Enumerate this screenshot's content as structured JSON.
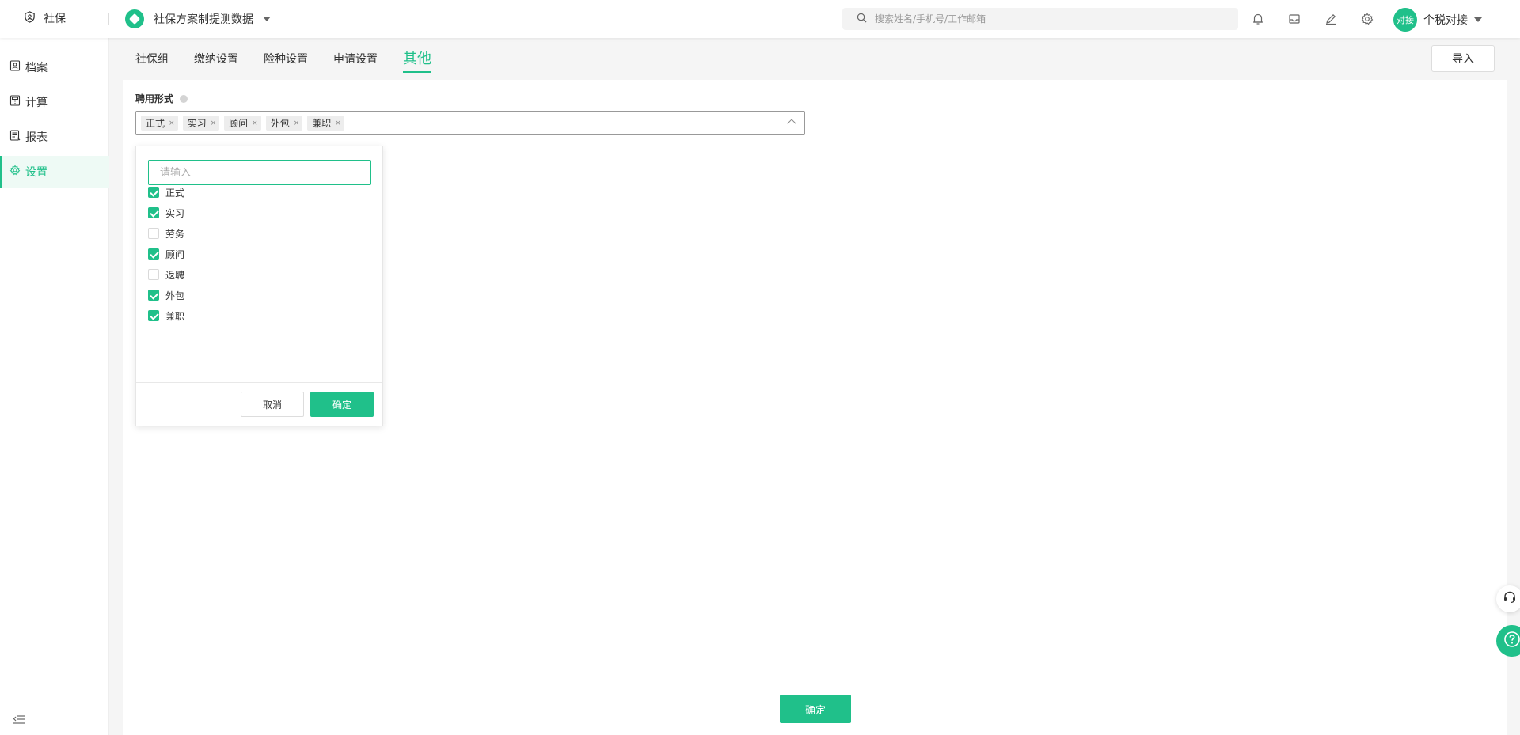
{
  "header": {
    "module_label": "社保",
    "scheme_name": "社保方案制提测数据",
    "search_placeholder": "搜索姓名/手机号/工作邮箱",
    "avatar_text": "对接",
    "user_name": "个税对接"
  },
  "sidebar": {
    "items": [
      {
        "label": "档案",
        "icon": "profile-icon"
      },
      {
        "label": "计算",
        "icon": "calculator-icon"
      },
      {
        "label": "报表",
        "icon": "report-icon"
      },
      {
        "label": "设置",
        "icon": "gear-icon",
        "active": true
      }
    ]
  },
  "tabs": [
    {
      "label": "社保组"
    },
    {
      "label": "缴纳设置"
    },
    {
      "label": "险种设置"
    },
    {
      "label": "申请设置"
    },
    {
      "label": "其他",
      "active": true
    }
  ],
  "import_label": "导入",
  "field": {
    "label": "聘用形式",
    "selected_tags": [
      "正式",
      "实习",
      "顾问",
      "外包",
      "兼职"
    ],
    "tag_close_glyph": "×"
  },
  "dropdown": {
    "search_placeholder": "请输入",
    "options": [
      {
        "label": "正式",
        "checked": true
      },
      {
        "label": "实习",
        "checked": true
      },
      {
        "label": "劳务",
        "checked": false
      },
      {
        "label": "顾问",
        "checked": true
      },
      {
        "label": "返聘",
        "checked": false
      },
      {
        "label": "外包",
        "checked": true
      },
      {
        "label": "兼职",
        "checked": true
      }
    ],
    "cancel_label": "取消",
    "ok_label": "确定"
  },
  "footer": {
    "confirm_label": "确定"
  },
  "colors": {
    "accent": "#20c08a"
  }
}
